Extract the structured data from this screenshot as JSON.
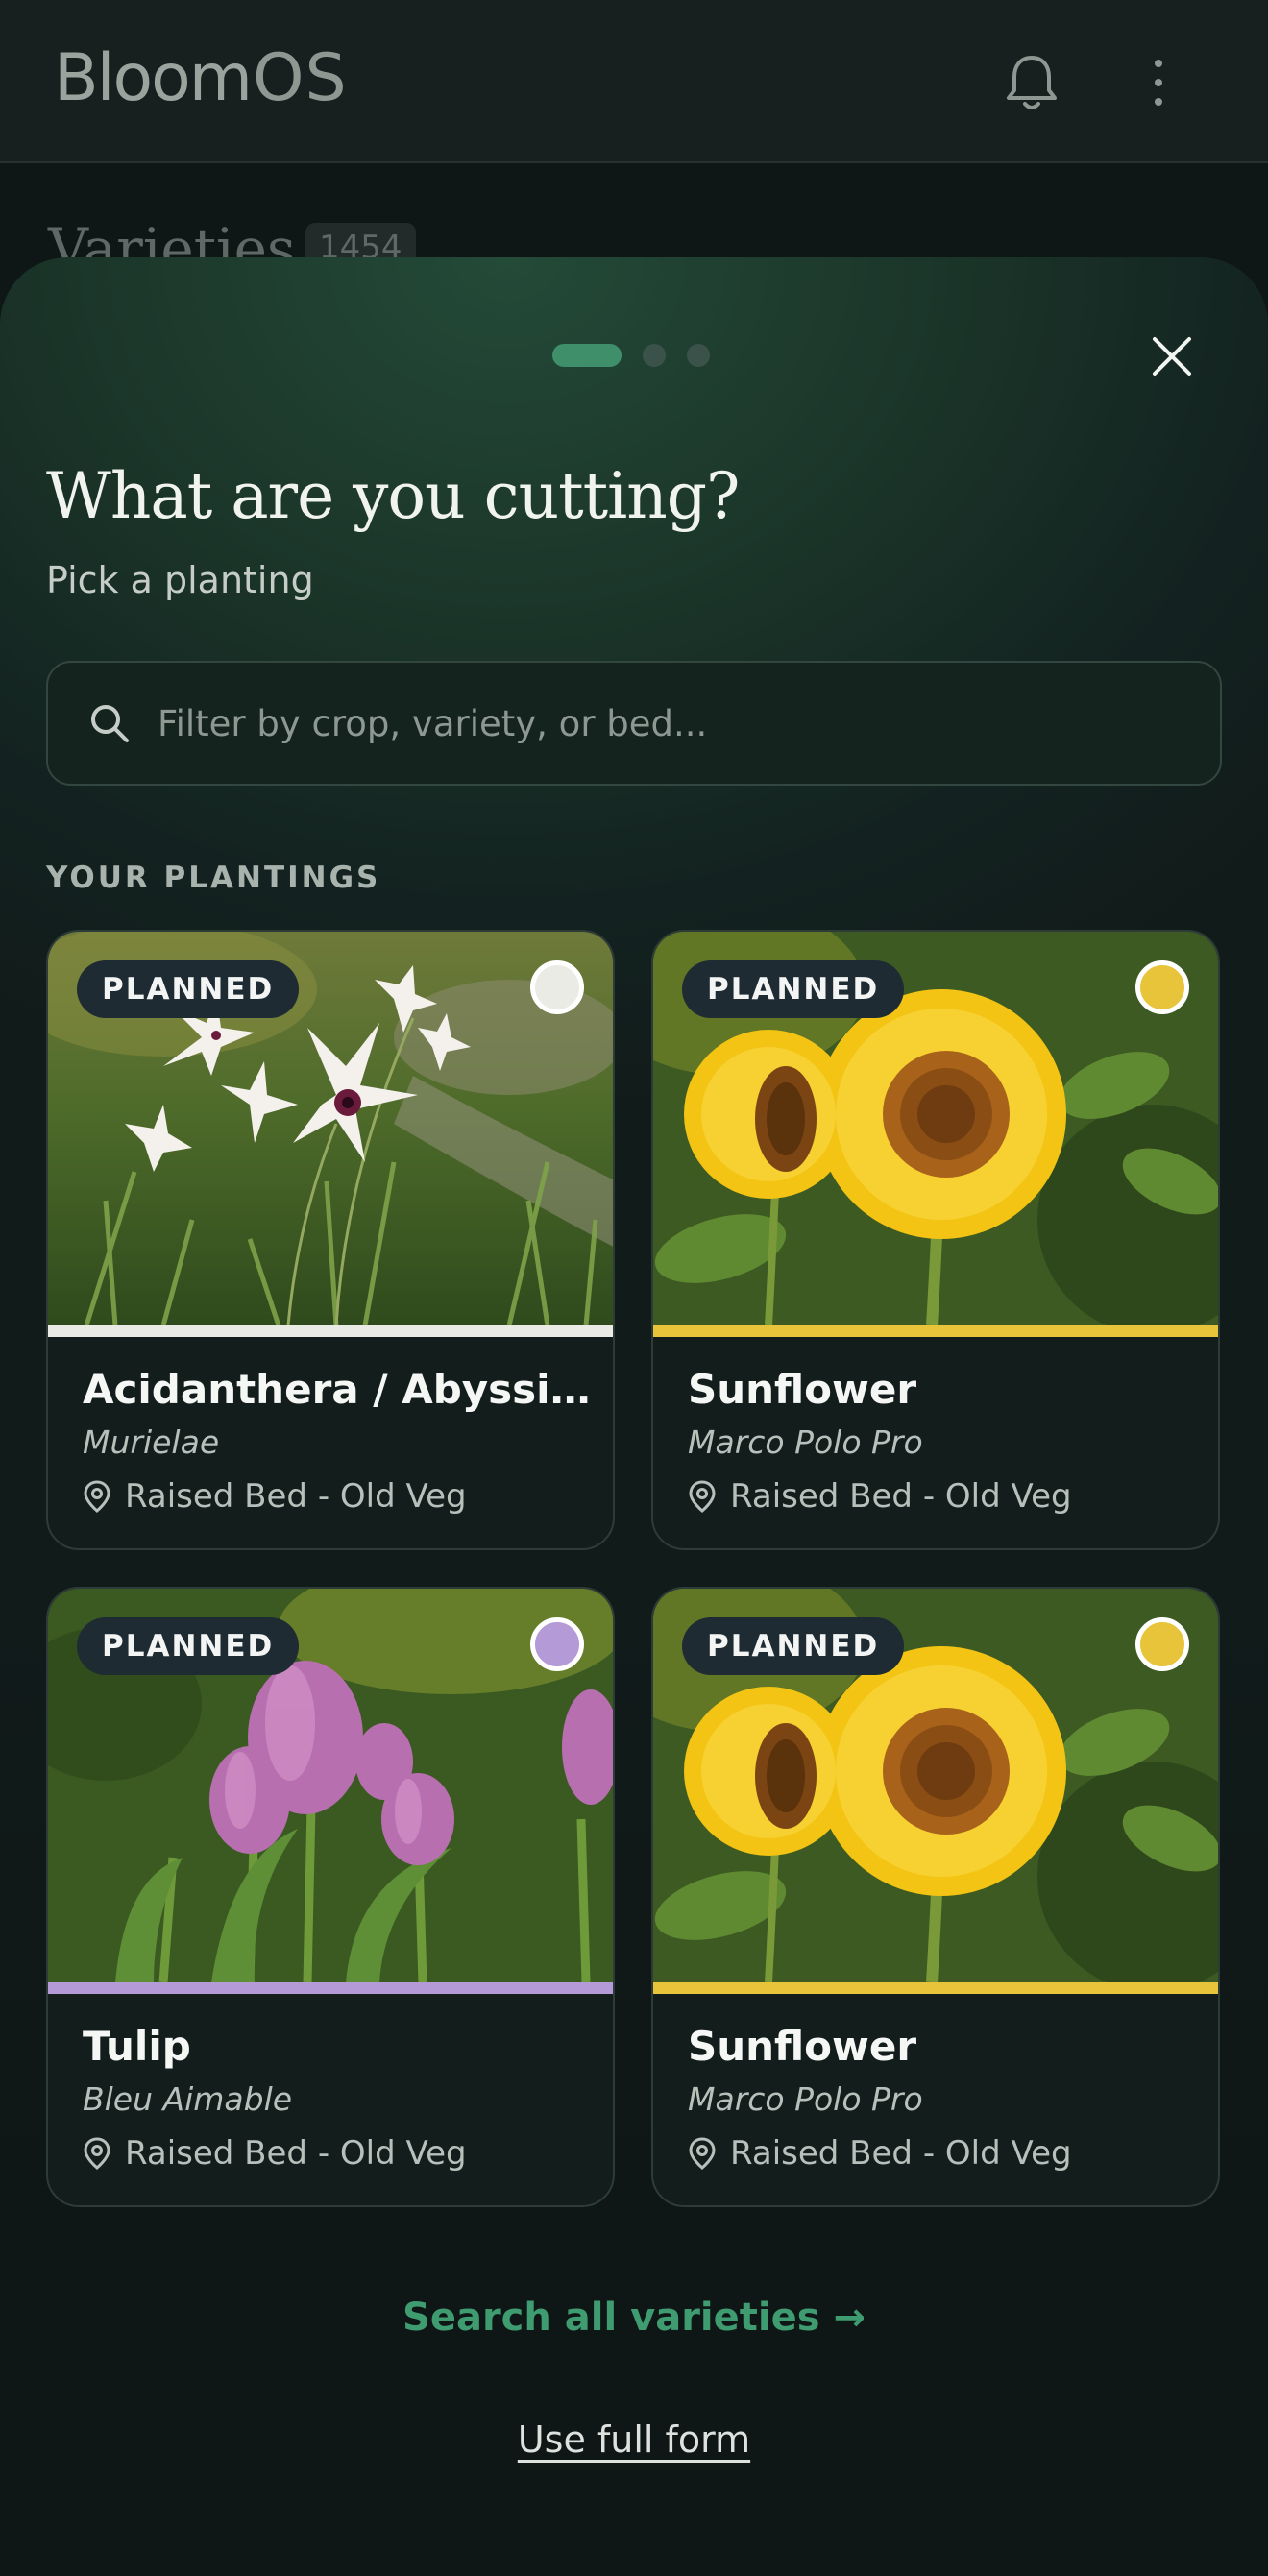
{
  "app": {
    "logo_main": "Bloom",
    "logo_suffix": "OS",
    "background_title": "Varieties",
    "background_count": "1454",
    "icons": [
      "bell-icon",
      "more-vertical-icon"
    ]
  },
  "sheet": {
    "steps": {
      "total": 3,
      "current": 1
    },
    "title": "What are you cutting?",
    "subtitle": "Pick a planting",
    "search": {
      "placeholder": "Filter by crop, variety, or bed...",
      "value": ""
    },
    "section_label": "YOUR PLANTINGS",
    "plantings": [
      {
        "status": "PLANNED",
        "name": "Acidanthera / Abyssinian Gladiolus",
        "variety": "Murielae",
        "location": "Raised Bed - Old Veg",
        "color": "#ebebe6",
        "photo": "white-acidanthera-flowers"
      },
      {
        "status": "PLANNED",
        "name": "Sunflower",
        "variety": "Marco Polo Pro",
        "location": "Raised Bed - Old Veg",
        "color": "#e8c43a",
        "photo": "sunflowers"
      },
      {
        "status": "PLANNED",
        "name": "Tulip",
        "variety": "Bleu Aimable",
        "location": "Raised Bed - Old Veg",
        "color": "#b49ad6",
        "photo": "purple-tulips"
      },
      {
        "status": "PLANNED",
        "name": "Sunflower",
        "variety": "Marco Polo Pro",
        "location": "Raised Bed - Old Veg",
        "color": "#e8c43a",
        "photo": "sunflowers"
      }
    ],
    "search_all_label": "Search all varieties →",
    "full_form_label": "Use full form",
    "colors": {
      "accent": "#3f9b70",
      "step_active": "#3f8f6a"
    }
  }
}
